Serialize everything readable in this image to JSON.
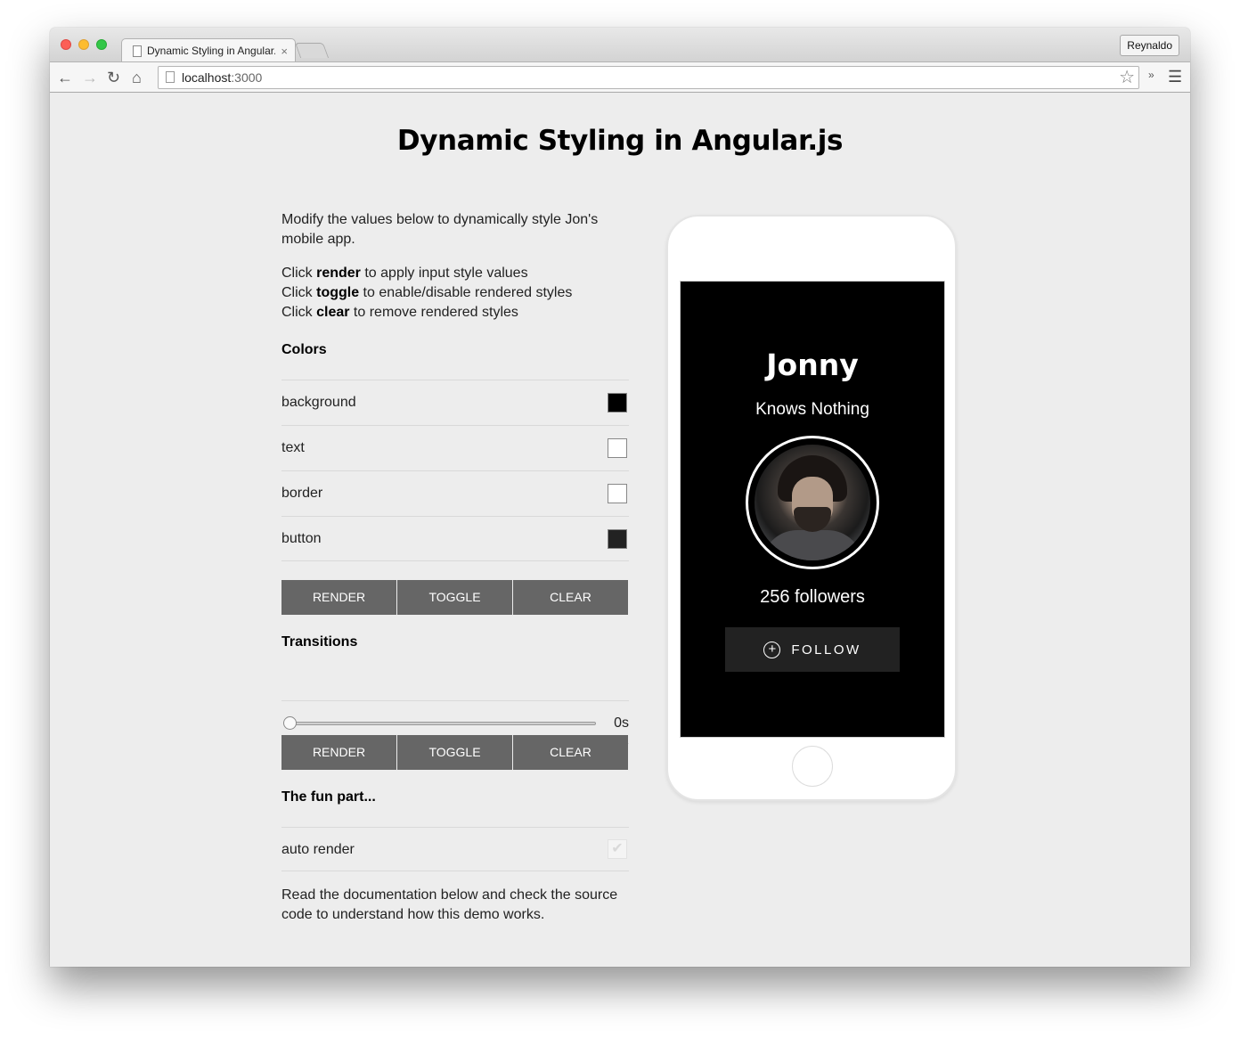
{
  "browser": {
    "tab_title": "Dynamic Styling in Angular.js",
    "tab_close": "×",
    "profile_name": "Reynaldo",
    "url_host": "localhost",
    "url_port": ":3000",
    "icons": [
      "back-arrow-icon",
      "forward-arrow-icon",
      "reload-icon",
      "home-icon",
      "bookmark-star-icon",
      "extensions-chevron-icon",
      "menu-icon"
    ]
  },
  "page": {
    "title": "Dynamic Styling in Angular.js",
    "intro": "Modify the values below to dynamically style Jon's mobile app.",
    "instructions": [
      {
        "prefix": "Click ",
        "keyword": "render",
        "suffix": " to apply input style values"
      },
      {
        "prefix": "Click ",
        "keyword": "toggle",
        "suffix": " to enable/disable rendered styles"
      },
      {
        "prefix": "Click ",
        "keyword": "clear",
        "suffix": " to remove rendered styles"
      }
    ],
    "colors_heading": "Colors",
    "colors": [
      {
        "label": "background",
        "value": "#000000"
      },
      {
        "label": "text",
        "value": "#ffffff"
      },
      {
        "label": "border",
        "value": "#ffffff"
      },
      {
        "label": "button",
        "value": "#222222"
      }
    ],
    "buttons": {
      "render": "RENDER",
      "toggle": "TOGGLE",
      "clear": "CLEAR"
    },
    "transitions_heading": "Transitions",
    "transition_value": 0,
    "transition_label": "0s",
    "fun_heading": "The fun part...",
    "auto_render_label": "auto render",
    "auto_render_checked": true,
    "outro": "Read the documentation below and check the source code to understand how this demo works."
  },
  "profile_card": {
    "name": "Jonny",
    "role": "Knows Nothing",
    "followers": "256 followers",
    "follow_label": "FOLLOW",
    "plus_glyph": "+"
  }
}
